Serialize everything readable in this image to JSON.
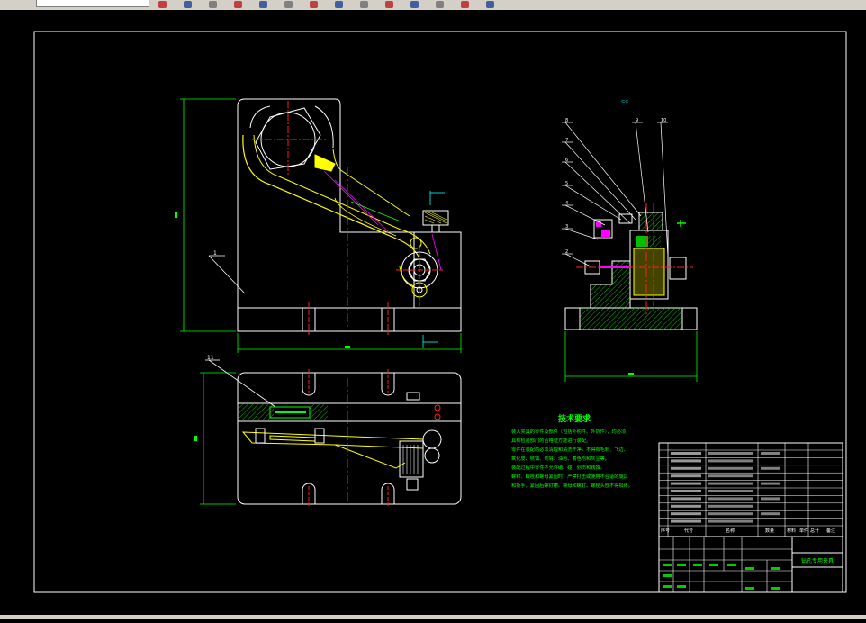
{
  "colors": {
    "background": "#000000",
    "frame": "#ffffff",
    "dimension": "#00ff00",
    "centerline": "#ff2020",
    "part_yellow": "#ffff00",
    "hatch": "#00c000",
    "magenta": "#ff00ff",
    "cyan": "#00ffff",
    "toolbar": "#d4d0c8"
  },
  "toolbar": {
    "icons": [
      "back-icon",
      "undo-icon",
      "redo-icon",
      "pan-icon",
      "zoom-icon",
      "window-icon",
      "properties-icon",
      "layer-icon",
      "match-icon",
      "color-icon",
      "linetype-icon",
      "line-icon",
      "arrow-icon",
      "help-icon"
    ]
  },
  "drawing": {
    "tech_requirements_title": "技术要求",
    "tech_requirements_lines": [
      "装入夹具的零件及部件（包括外购件、外协件），均必须",
      "具有检验部门的合格证方能进行装配。",
      "零件在装配前必须清理和清洗干净，不得有毛刺、飞边、",
      "氧化皮、锈蚀、切屑、油污、着色剂和灰尘等。",
      "装配过程中零件不允许磕、碰、划伤和锈蚀。",
      "螺钉、螺栓和螺母紧固时，严禁打击或使用不合适的旋具",
      "和扳手，紧固后螺钉槽、螺母和螺钉、螺栓头部不得损坏。"
    ],
    "balloons_side_view": [
      "8",
      "7",
      "6",
      "5",
      "4",
      "3",
      "2",
      "9",
      "10"
    ],
    "balloon_front_view": "1",
    "balloon_top_view": "11",
    "title_block": {
      "drawing_name": "钻孔专用夹具",
      "header_labels": [
        "序号",
        "代号",
        "名称",
        "数量",
        "材料",
        "单件",
        "总计",
        "备注"
      ]
    }
  }
}
